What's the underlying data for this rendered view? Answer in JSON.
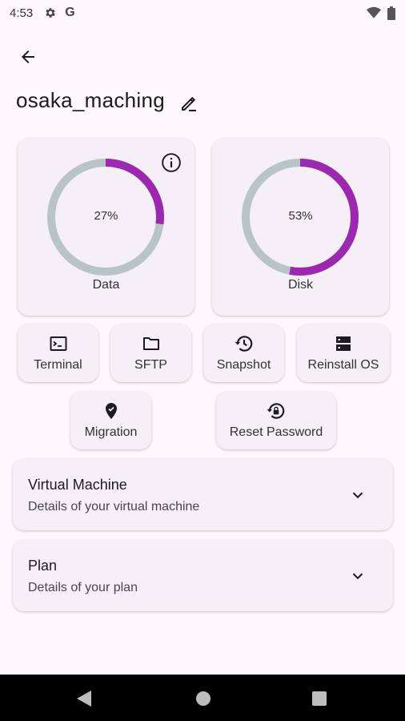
{
  "status_bar": {
    "time": "4:53",
    "g_label": "G"
  },
  "server": {
    "name": "osaka_maching"
  },
  "gauges": {
    "data": {
      "label": "Data",
      "value_text": "27%",
      "percent": 27
    },
    "disk": {
      "label": "Disk",
      "value_text": "53%",
      "percent": 53
    }
  },
  "actions": {
    "terminal": "Terminal",
    "sftp": "SFTP",
    "snapshot": "Snapshot",
    "reinstall": "Reinstall OS",
    "migration": "Migration",
    "reset_password": "Reset Password"
  },
  "sections": {
    "vm": {
      "title": "Virtual Machine",
      "subtitle": "Details of your virtual machine"
    },
    "plan": {
      "title": "Plan",
      "subtitle": "Details of your plan"
    }
  },
  "colors": {
    "accent": "#9c27b0",
    "track": "#b8c4c6",
    "card": "#f5eff6",
    "background": "#fcf8fc"
  },
  "icons": {
    "back": "arrow-left-icon",
    "edit": "edit-pencil-icon",
    "info": "info-icon",
    "terminal": "terminal-icon",
    "sftp": "folder-icon",
    "snapshot": "history-icon",
    "reinstall": "dns-server-icon",
    "migration": "location-pin-icon",
    "reset_password": "lock-reset-icon",
    "chevron": "chevron-down-icon"
  }
}
